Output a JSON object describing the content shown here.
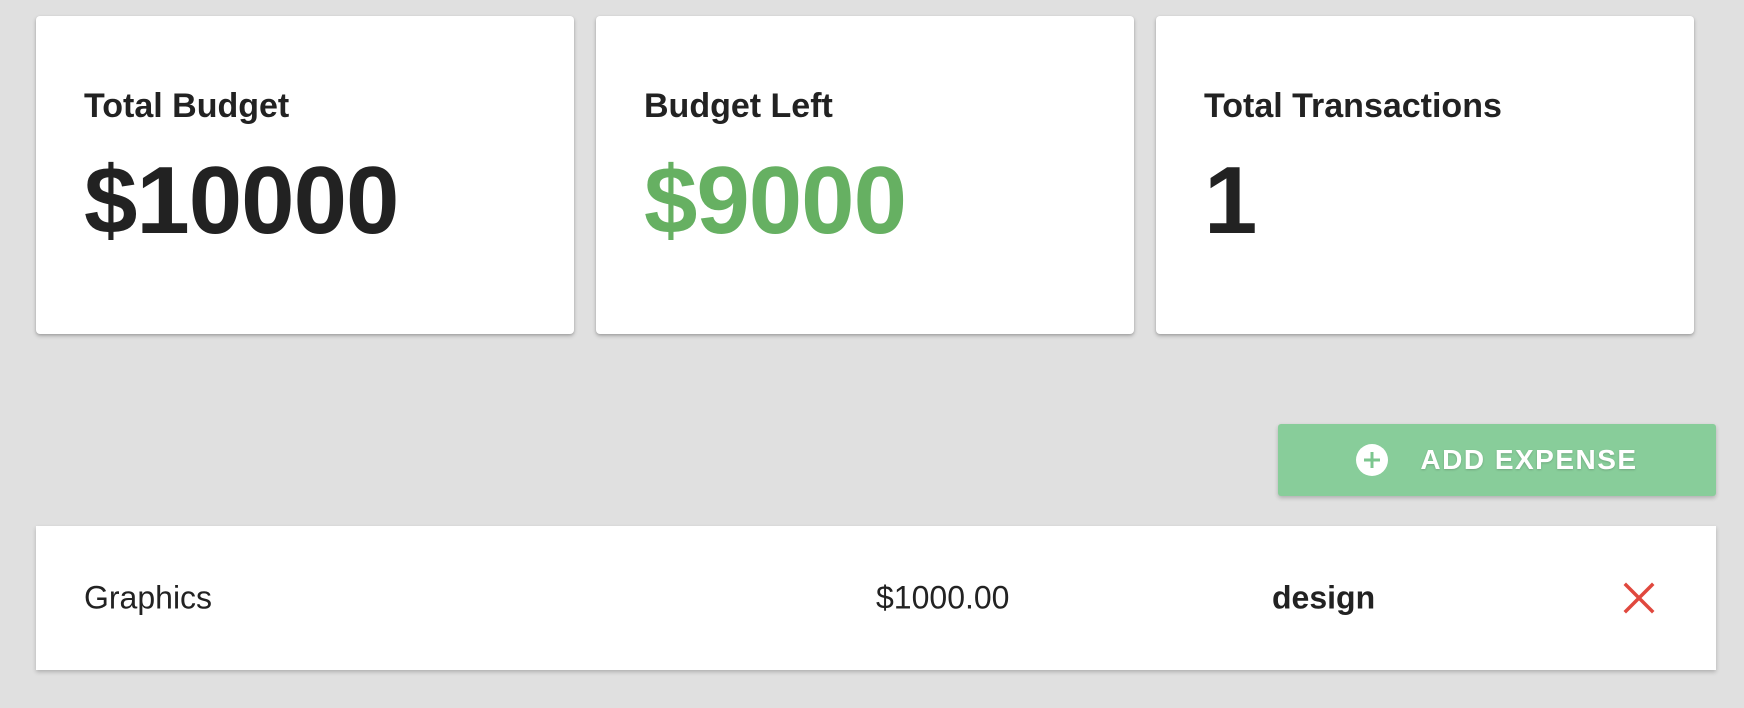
{
  "summary": {
    "total_budget": {
      "label": "Total Budget",
      "value": "$10000"
    },
    "budget_left": {
      "label": "Budget Left",
      "value": "$9000"
    },
    "total_transactions": {
      "label": "Total Transactions",
      "value": "1"
    }
  },
  "actions": {
    "add_expense_label": "ADD EXPENSE",
    "add_icon": "plus-circle-icon"
  },
  "expenses": [
    {
      "name": "Graphics",
      "amount": "$1000.00",
      "category": "design",
      "delete_icon": "close-icon"
    }
  ],
  "colors": {
    "background": "#e0e0e0",
    "card": "#ffffff",
    "positive": "#66b062",
    "accent_button": "#88cd9a",
    "delete": "#e0483e",
    "text": "#222222"
  }
}
